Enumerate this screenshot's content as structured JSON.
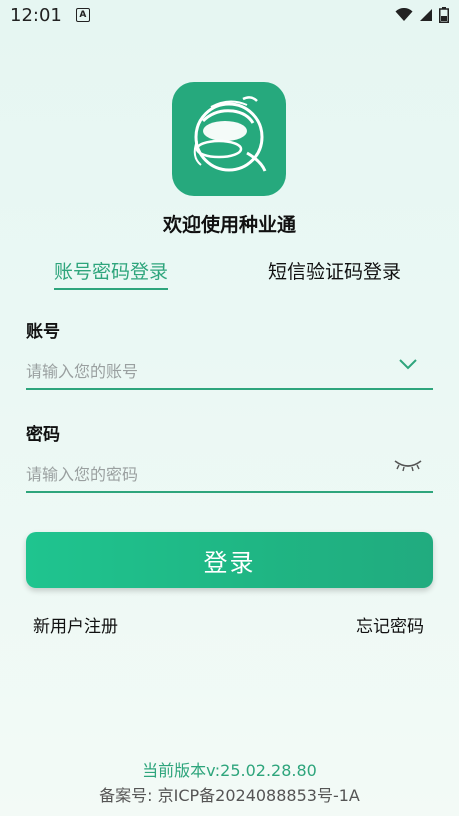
{
  "status_bar": {
    "time": "12:01",
    "notification_icon": "A"
  },
  "app": {
    "title": "欢迎使用种业通"
  },
  "tabs": [
    {
      "label": "账号密码登录",
      "active": true
    },
    {
      "label": "短信验证码登录",
      "active": false
    }
  ],
  "form": {
    "account_label": "账号",
    "account_placeholder": "请输入您的账号",
    "password_label": "密码",
    "password_placeholder": "请输入您的密码",
    "login_button": "登录"
  },
  "links": {
    "register": "新用户注册",
    "forgot_password": "忘记密码"
  },
  "footer": {
    "version": "当前版本v:25.02.28.80",
    "beian": "备案号: 京ICP备2024088853号-1A"
  },
  "colors": {
    "accent": "#2ea57c",
    "logo_bg": "#26a97d",
    "button_start": "#1fc48f",
    "button_end": "#21ab7f"
  }
}
